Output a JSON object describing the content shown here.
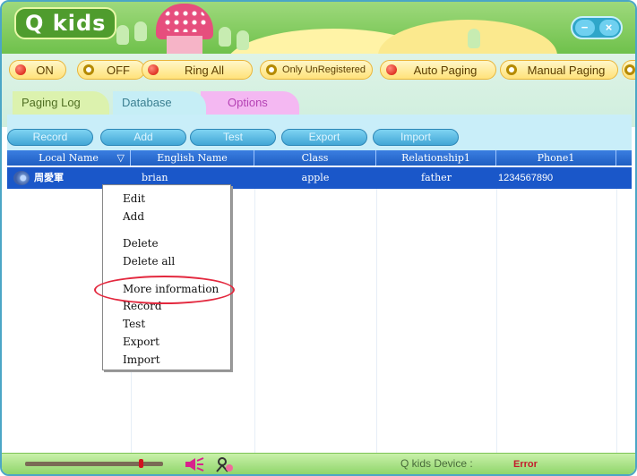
{
  "app": {
    "title": "Q kids"
  },
  "window_controls": {
    "minimize": "−",
    "close": "×"
  },
  "toolbar": {
    "on": "ON",
    "off": "OFF",
    "ring_all": "Ring All",
    "only_unregistered": "Only UnRegistered",
    "auto_paging": "Auto Paging",
    "manual_paging": "Manual Paging"
  },
  "tabs": {
    "paging_log": "Paging Log",
    "database": "Database",
    "options": "Options",
    "active": "Database"
  },
  "subtoolbar": {
    "record": "Record",
    "add": "Add",
    "test": "Test",
    "export": "Export",
    "import": "Import"
  },
  "table": {
    "columns": [
      "Local Name",
      "English Name",
      "Class",
      "Relationship1",
      "Phone1"
    ],
    "sort_indicator": "▽",
    "rows": [
      {
        "local_name": "周愛軍",
        "english_name": "brian",
        "class": "apple",
        "relationship": "father",
        "phone": "1234567890"
      }
    ]
  },
  "context_menu": {
    "items": [
      "Edit",
      "Add",
      "Delete",
      "Delete all",
      "More information",
      "Record",
      "Test",
      "Export",
      "Import"
    ],
    "highlighted": "More information"
  },
  "statusbar": {
    "volume_level": 0.85,
    "device_label": "Q kids Device :",
    "device_status": "Error"
  },
  "colors": {
    "accent": "#2fa6c9",
    "selection": "#1a57c9",
    "highlight_ring": "#e3283e"
  }
}
